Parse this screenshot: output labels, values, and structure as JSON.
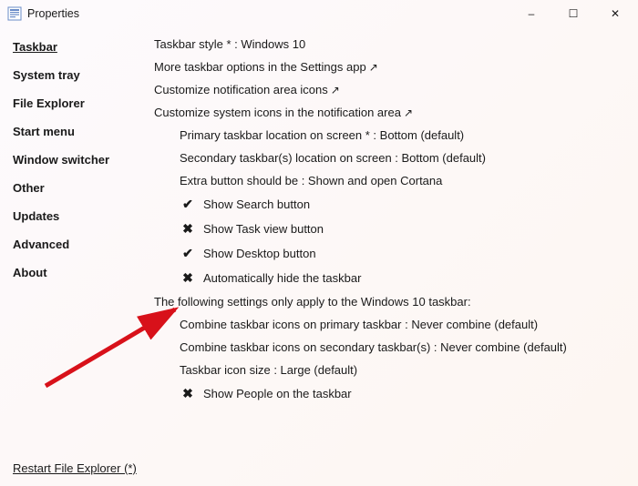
{
  "titlebar": {
    "title": "Properties"
  },
  "sidebar": {
    "items": [
      {
        "label": "Taskbar",
        "selected": true
      },
      {
        "label": "System tray"
      },
      {
        "label": "File Explorer"
      },
      {
        "label": "Start menu"
      },
      {
        "label": "Window switcher"
      },
      {
        "label": "Other"
      },
      {
        "label": "Updates"
      },
      {
        "label": "Advanced"
      },
      {
        "label": "About"
      }
    ]
  },
  "main": {
    "rows": [
      {
        "text": "Taskbar style * : Windows 10"
      },
      {
        "text": "More taskbar options in the Settings app",
        "link": true
      },
      {
        "text": "Customize notification area icons",
        "link": true
      },
      {
        "text": "Customize system icons in the notification area",
        "link": true
      },
      {
        "text": "Primary taskbar location on screen * : Bottom (default)",
        "indent": 1
      },
      {
        "text": "Secondary taskbar(s) location on screen : Bottom (default)",
        "indent": 1
      },
      {
        "text": "Extra button should be : Shown and open Cortana",
        "indent": 1
      },
      {
        "text": "Show Search button",
        "indent": 1,
        "check": true
      },
      {
        "text": "Show Task view button",
        "indent": 1,
        "check": false
      },
      {
        "text": "Show Desktop button",
        "indent": 1,
        "check": true
      },
      {
        "text": "Automatically hide the taskbar",
        "indent": 1,
        "check": false
      },
      {
        "text": "The following settings only apply to the Windows 10 taskbar:"
      },
      {
        "text": "Combine taskbar icons on primary taskbar : Never combine (default)",
        "indent": 1
      },
      {
        "text": "Combine taskbar icons on secondary taskbar(s) : Never combine (default)",
        "indent": 1
      },
      {
        "text": "Taskbar icon size : Large (default)",
        "indent": 1
      },
      {
        "text": "Show People on the taskbar",
        "indent": 1,
        "check": false
      }
    ]
  },
  "footer": {
    "restart_label": "Restart File Explorer (*)"
  },
  "glyphs": {
    "check": "✔",
    "cross": "✖",
    "link_arrow": "↗",
    "minimize": "–",
    "maximize": "☐",
    "close": "✕"
  }
}
